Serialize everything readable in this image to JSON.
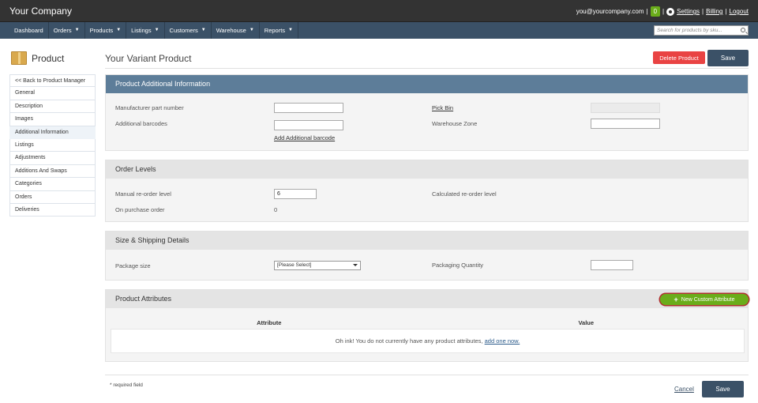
{
  "app": {
    "brand": "Your Company",
    "user_email": "you@yourcompany.com",
    "notif_count": "0",
    "settings_label": "Settings",
    "billing_label": "Billing",
    "logout_label": "Logout",
    "sep": "|"
  },
  "nav": {
    "items": [
      {
        "label": "Dashboard",
        "caret": ""
      },
      {
        "label": "Orders",
        "caret": "▼"
      },
      {
        "label": "Products",
        "caret": "▼"
      },
      {
        "label": "Listings",
        "caret": "▼"
      },
      {
        "label": "Customers",
        "caret": "▼"
      },
      {
        "label": "Warehouse",
        "caret": "▼"
      },
      {
        "label": "Reports",
        "caret": "▼"
      }
    ],
    "search_placeholder": "Search for products by sku..."
  },
  "sidebar": {
    "title": "Product",
    "items": [
      "<< Back to Product Manager",
      "General",
      "Description",
      "Images",
      "Additional Information",
      "Listings",
      "Adjustments",
      "Additions And Swaps",
      "Categories",
      "Orders",
      "Deliveries"
    ],
    "active_index": 4
  },
  "page": {
    "title": "Your Variant Product",
    "delete_label": "Delete Product",
    "save_label": "Save"
  },
  "additional_info": {
    "heading": "Product Additional Information",
    "mpn_label": "Manufacturer part number",
    "mpn_value": "",
    "barcodes_label": "Additional barcodes",
    "barcodes_value": "",
    "add_barcode_link": "Add Additional barcode",
    "pick_bin_label": "Pick Bin",
    "pick_bin_value": "",
    "warehouse_zone_label": "Warehouse Zone",
    "warehouse_zone_value": ""
  },
  "order_levels": {
    "heading": "Order Levels",
    "manual_label": "Manual re-order level",
    "manual_value": "6",
    "purchase_label": "On purchase order",
    "purchase_value": "0",
    "calculated_label": "Calculated re-order level"
  },
  "shipping": {
    "heading": "Size & Shipping Details",
    "package_label": "Package size",
    "package_selected": "[Please Select]",
    "packaging_qty_label": "Packaging Quantity",
    "packaging_qty_value": ""
  },
  "attributes": {
    "heading": "Product Attributes",
    "new_button": "New Custom Attribute",
    "col_attribute": "Attribute",
    "col_value": "Value",
    "empty_text": "Oh ink! You do not currently have any product attributes,",
    "empty_link": "add one now."
  },
  "footer": {
    "required_note": "* required field",
    "cancel_label": "Cancel",
    "save_label": "Save"
  }
}
